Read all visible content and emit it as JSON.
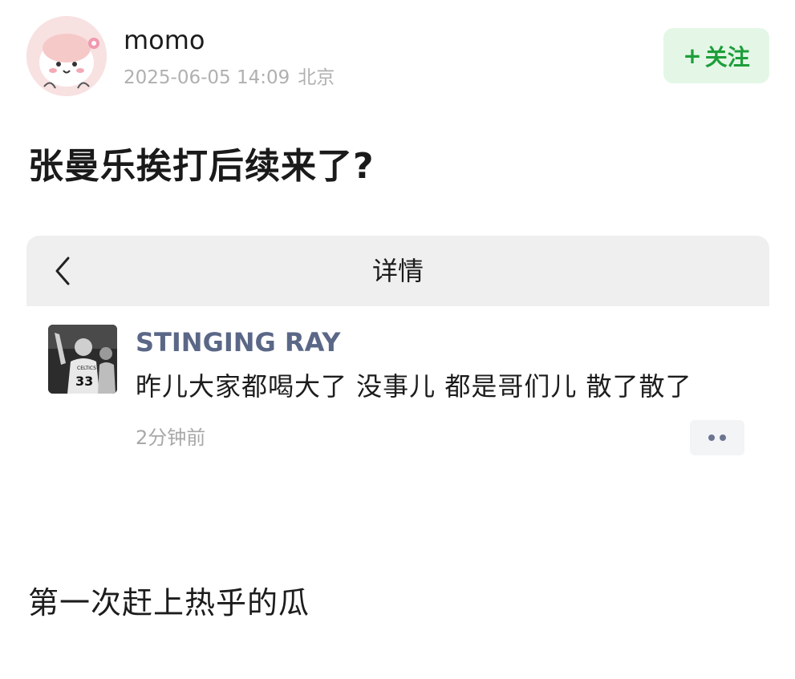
{
  "post": {
    "author": "momo",
    "date": "2025-06-05 14:09",
    "location": "北京",
    "follow_plus": "+",
    "follow_label": "关注",
    "title": "张曼乐挨打后续来了?",
    "caption": "第一次赶上热乎的瓜"
  },
  "screenshot": {
    "header_title": "详情",
    "comment": {
      "author": "STINGING RAY",
      "text": "昨儿大家都喝大了 没事儿 都是哥们儿 散了散了",
      "time": "2分钟前",
      "jersey_number": "33",
      "jersey_team": "CELTICS"
    }
  },
  "icons": {
    "back": "chevron-left-icon",
    "more": "more-dots-icon"
  },
  "colors": {
    "follow_bg": "#e4f7e6",
    "follow_text": "#1e9e3a",
    "comment_name": "#5b6787",
    "screenshot_header_bg": "#efefef"
  }
}
